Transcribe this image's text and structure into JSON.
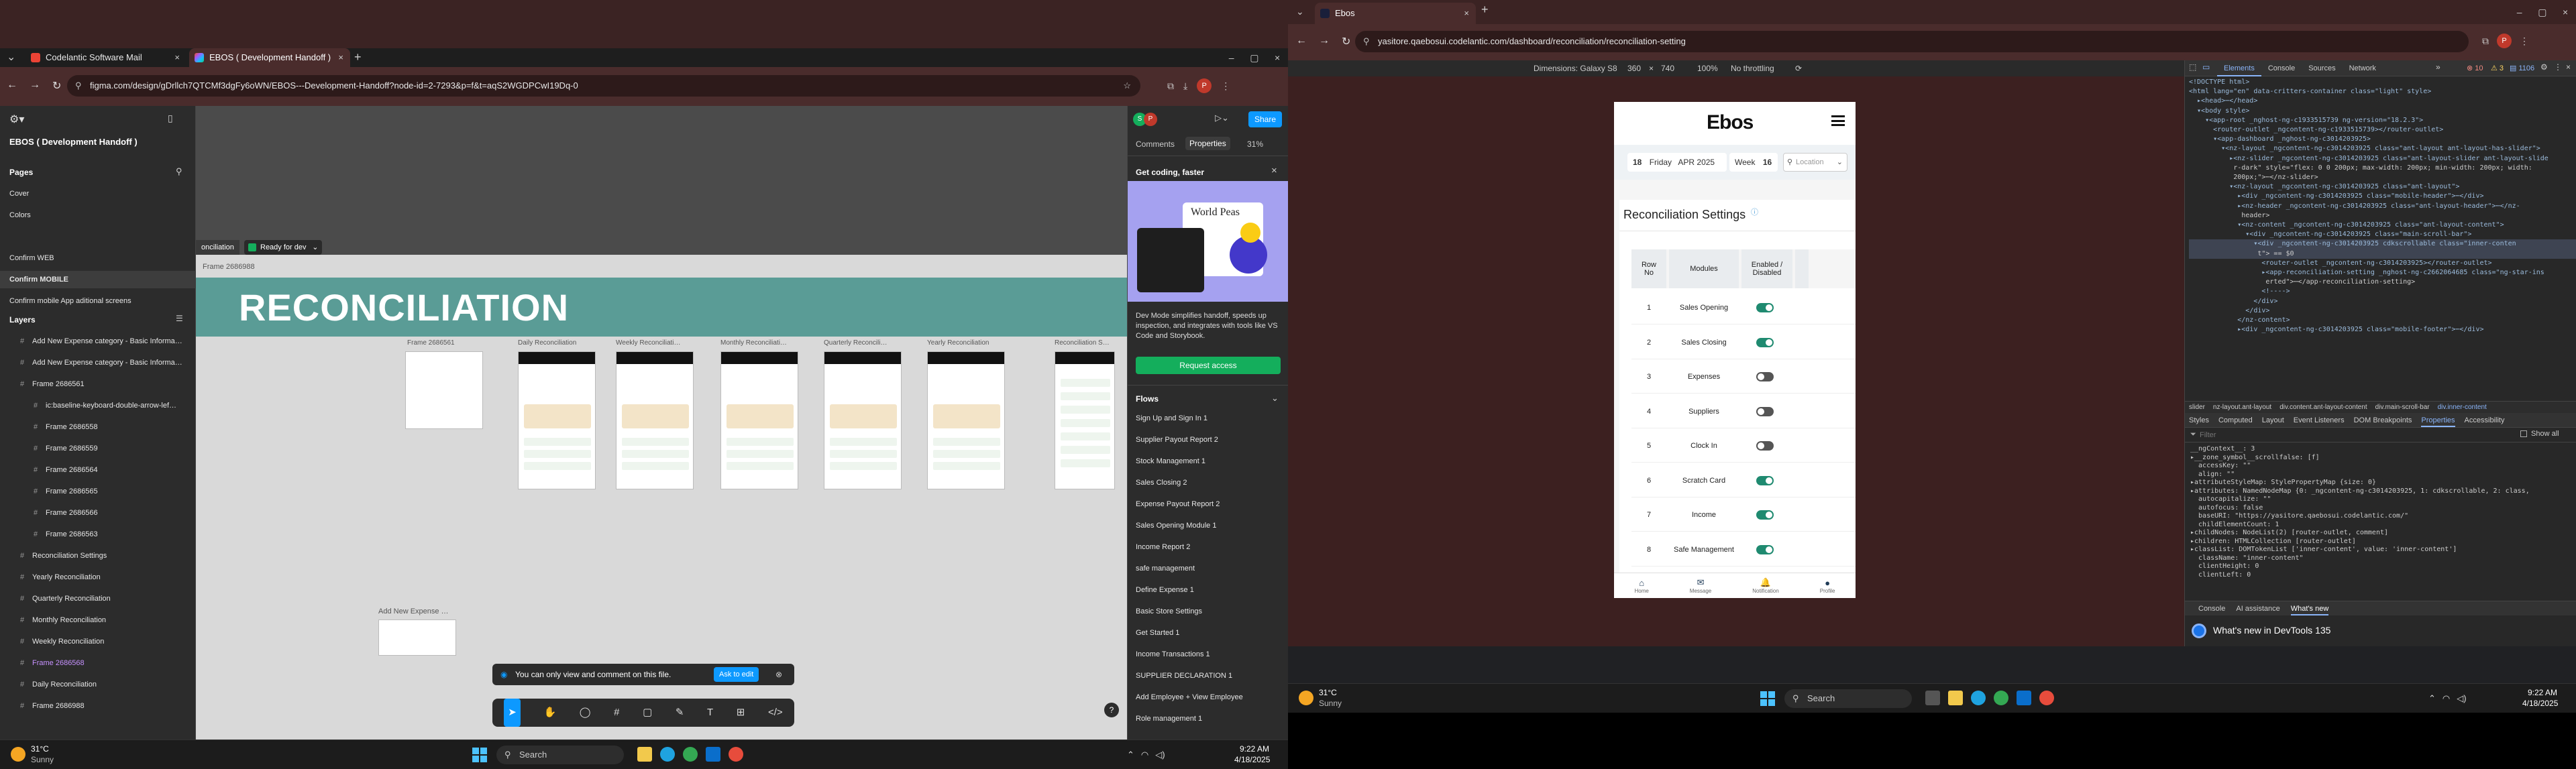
{
  "left": {
    "tabs": [
      {
        "label": "Codelantic Software Mail"
      },
      {
        "label": "EBOS ( Development Handoff )"
      }
    ],
    "url": "figma.com/design/gDrllch7QTCMf3dgFy6oWN/EBOS---Development-Handoff?node-id=2-7293&p=f&t=aqS2WGDPCwI19Dq-0",
    "figma": {
      "file_title": "EBOS ( Development Handoff )",
      "pages_label": "Pages",
      "pages": [
        "Cover",
        "Colors",
        "Confirm WEB",
        "Confirm  MOBILE",
        "Confirm mobile App aditional screens"
      ],
      "layers_label": "Layers",
      "layers": [
        "Add New Expense category - Basic Informa…",
        "Add New Expense category - Basic Informa…",
        "Frame 2686561",
        "ic:baseline-keyboard-double-arrow-lef…",
        "Frame 2686558",
        "Frame 2686559",
        "Frame 2686564",
        "Frame 2686565",
        "Frame 2686566",
        "Frame 2686563",
        "Reconciliation Settings",
        "Yearly Reconciliation",
        "Quarterly Reconciliation",
        "Monthly Reconciliation",
        "Weekly Reconciliation",
        "Frame 2686568",
        "Daily Reconciliation",
        "Frame 2686988"
      ],
      "canvas": {
        "section_tab": "onciliation",
        "ready_label": "Ready for dev",
        "frame_label": "Frame 2686988",
        "heading": "RECONCILIATION",
        "frames": [
          "Frame 2686561",
          "Daily Reconciliation",
          "Weekly Reconciliati…",
          "Monthly Reconciliati…",
          "Quarterly Reconcili…",
          "Yearly Reconciliation",
          "Reconciliation S…"
        ],
        "add_new_expense": "Add New Expense …",
        "notice": "You can only view and comment on this file.",
        "ask_to_edit": "Ask to edit",
        "help": "?"
      },
      "right_panel": {
        "avatar1": "S",
        "avatar2": "P",
        "share": "Share",
        "tab_comments": "Comments",
        "tab_properties": "Properties",
        "zoom": "31%",
        "get_coding": "Get coding, faster",
        "preview_text": "World Peas",
        "description": "Dev Mode simplifies handoff, speeds up inspection, and integrates with tools like VS Code and Storybook.",
        "request_access": "Request access",
        "flows_label": "Flows",
        "flows": [
          "Sign Up and Sign In 1",
          "Supplier Payout Report 2",
          "Stock Management 1",
          "Sales Closing 2",
          "Expense Payout Report 2",
          "Sales Opening Module 1",
          "Income Report 2",
          "safe management",
          "Define Expense 1",
          "Basic Store Settings",
          "Get Started 1",
          "Income Transactions 1",
          "SUPPLIER DECLARATION 1",
          "Add Employee + View Employee",
          "Role management 1"
        ]
      }
    },
    "taskbar": {
      "weather_temp": "31°C",
      "weather_desc": "Sunny",
      "search": "Search",
      "time": "9:22 AM",
      "date": "4/18/2025"
    }
  },
  "right": {
    "tab_title": "Ebos",
    "url": "yasitore.qaebosui.codelantic.com/dashboard/reconciliation/reconciliation-setting",
    "device_toolbar": {
      "dimensions_label": "Dimensions: Galaxy S8",
      "width": "360",
      "times": "×",
      "height": "740",
      "zoom": "100%",
      "throttle": "No throttling"
    },
    "app": {
      "logo": "Ebos",
      "date_day": "18",
      "date_weekday": "Friday",
      "date_monthyear": "APR 2025",
      "week_label": "Week",
      "week_num": "16",
      "location_placeholder": "Location",
      "page_title": "Reconciliation Settings",
      "info_icon": "ⓘ",
      "headers": [
        "Row No",
        "Modules",
        "Enabled / Disabled"
      ],
      "rows": [
        {
          "no": "1",
          "module": "Sales Opening",
          "on": true
        },
        {
          "no": "2",
          "module": "Sales Closing",
          "on": true
        },
        {
          "no": "3",
          "module": "Expenses",
          "on": false
        },
        {
          "no": "4",
          "module": "Suppliers",
          "on": false
        },
        {
          "no": "5",
          "module": "Clock In",
          "on": false
        },
        {
          "no": "6",
          "module": "Scratch Card",
          "on": true
        },
        {
          "no": "7",
          "module": "Income",
          "on": true
        },
        {
          "no": "8",
          "module": "Safe Management",
          "on": true
        }
      ],
      "nav": [
        "Home",
        "Message",
        "Notification",
        "Profile"
      ]
    },
    "devtools": {
      "tabs": [
        "Elements",
        "Console",
        "Sources",
        "Network"
      ],
      "errors": "10",
      "warnings": "3",
      "info": "1106",
      "dom_lines": [
        "<!DOCTYPE html>",
        "<html lang=\"en\" data-critters-container class=\"light\" style>",
        "  ▸<head>⋯</head>",
        "  ▾<body style>",
        "    ▾<app-root _nghost-ng-c1933515739 ng-version=\"18.2.3\">",
        "      <router-outlet _ngcontent-ng-c1933515739></router-outlet>",
        "      ▾<app-dashboard _nghost-ng-c3014203925>",
        "        ▾<nz-layout _ngcontent-ng-c3014203925 class=\"ant-layout ant-layout-has-slider\">",
        "          ▸<nz-slider _ngcontent-ng-c3014203925 class=\"ant-layout-slider ant-layout-slide",
        "           r-dark\" style=\"flex: 0 0 200px; max-width: 200px; min-width: 200px; width:",
        "           200px;\">⋯</nz-slider>",
        "          ▾<nz-layout _ngcontent-ng-c3014203925 class=\"ant-layout\">",
        "            ▸<div _ngcontent-ng-c3014203925 class=\"mobile-header\">⋯</div>",
        "            ▸<nz-header _ngcontent-ng-c3014203925 class=\"ant-layout-header\">⋯</nz-",
        "             header>",
        "            ▾<nz-content _ngcontent-ng-c3014203925 class=\"ant-layout-content\">",
        "              ▾<div _ngcontent-ng-c3014203925 class=\"main-scroll-bar\">",
        "                ▾<div _ngcontent-ng-c3014203925 cdkscrollable class=\"inner-conten",
        "                 t\"> == $0",
        "                  <router-outlet _ngcontent-ng-c3014203925></router-outlet>",
        "                  ▸<app-reconciliation-setting _nghost-ng-c2662064685 class=\"ng-star-ins",
        "                   erted\">⋯</app-reconciliation-setting>",
        "                  <!---->",
        "                </div>",
        "              </div>",
        "            </nz-content>",
        "            ▸<div _ngcontent-ng-c3014203925 class=\"mobile-footer\">⋯</div>"
      ],
      "breadcrumb": [
        "slider",
        "nz-layout.ant-layout",
        "div.content.ant-layout-content",
        "div.main-scroll-bar",
        "div.inner-content"
      ],
      "prop_tabs": [
        "Styles",
        "Computed",
        "Layout",
        "Event Listeners",
        "DOM Breakpoints",
        "Properties",
        "Accessibility"
      ],
      "filter_placeholder": "Filter",
      "show_all": "Show all",
      "prop_lines": [
        "__ngContext__: 3",
        "▸__zone_symbol__scrollfalse: [f]",
        "  accessKey: \"\"",
        "  align: \"\"",
        "▸attributeStyleMap: StylePropertyMap {size: 0}",
        "▸attributes: NamedNodeMap {0: _ngcontent-ng-c3014203925, 1: cdkscrollable, 2: class,",
        "  autocapitalize: \"\"",
        "  autofocus: false",
        "  baseURI: \"https://yasitore.qaebosui.codelantic.com/\"",
        "  childElementCount: 1",
        "▸childNodes: NodeList(2) [router-outlet, comment]",
        "▸children: HTMLCollection [router-outlet]",
        "▸classList: DOMTokenList ['inner-content', value: 'inner-content']",
        "  className: \"inner-content\"",
        "  clientHeight: 0",
        "  clientLeft: 0"
      ],
      "drawer_tabs": [
        "Console",
        "AI assistance",
        "What's new"
      ],
      "whats_new": "What's new in DevTools 135"
    },
    "taskbar": {
      "weather_temp": "31°C",
      "weather_desc": "Sunny",
      "search": "Search",
      "time": "9:22 AM",
      "date": "4/18/2025"
    }
  }
}
